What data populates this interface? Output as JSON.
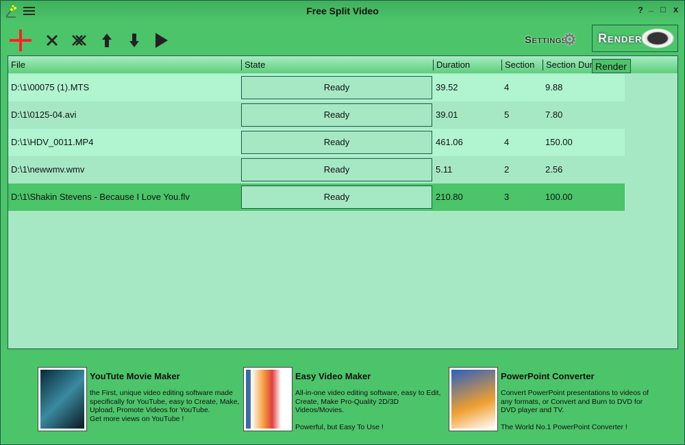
{
  "window": {
    "title": "Free Split Video",
    "help": "?",
    "minimize": "_",
    "maximize": "□",
    "close": "x"
  },
  "toolbar": {
    "settings_label": "Settings",
    "render_label": "Render",
    "tooltip": "Render",
    "icons": [
      "add-icon",
      "remove-icon",
      "remove-all-icon",
      "move-up-icon",
      "move-down-icon",
      "play-icon"
    ]
  },
  "table": {
    "columns": [
      "File",
      "State",
      "Duration",
      "Section",
      "Section Duration"
    ],
    "rows": [
      {
        "file": "D:\\1\\00075 (1).MTS",
        "state": "Ready",
        "duration": "39.52",
        "section": "4",
        "section_duration": "9.88"
      },
      {
        "file": "D:\\1\\0125-04.avi",
        "state": "Ready",
        "duration": "39.01",
        "section": "5",
        "section_duration": "7.80"
      },
      {
        "file": "D:\\1\\HDV_0011.MP4",
        "state": "Ready",
        "duration": "461.06",
        "section": "4",
        "section_duration": "150.00"
      },
      {
        "file": "D:\\1\\newwmv.wmv",
        "state": "Ready",
        "duration": "5.11",
        "section": "2",
        "section_duration": "2.56"
      },
      {
        "file": "D:\\1\\Shakin Stevens - Because I Love You.flv",
        "state": "Ready",
        "duration": "210.80",
        "section": "3",
        "section_duration": "100.00"
      }
    ],
    "selected_row": 4
  },
  "promos": [
    {
      "title": "YouTute Movie Maker",
      "desc": "the First, unique video editing software made specifically for YouTube, easy to Create, Make, Upload, Promote Videos for YouTube.\nGet more views on YouTube !"
    },
    {
      "title": "Easy Video Maker",
      "desc": "All-in-one video editing software, easy to Edit, Create, Make Pro-Quality 2D/3D Videos/Movies.\n\nPowerful, but Easy To Use !"
    },
    {
      "title": "PowerPoint Converter",
      "desc": "Convert PowerPoint presentations to videos of any formats, or Convert and Burn to DVD for DVD player and TV.\n\nThe World No.1 PowerPoint Converter !"
    }
  ],
  "colors": {
    "background": "#4cc46a",
    "row_light": "#b0f4d0",
    "row_dark": "#a6e8c4",
    "selected": "#4cc46a",
    "border": "#1f5a48",
    "add": "#ff2020"
  }
}
